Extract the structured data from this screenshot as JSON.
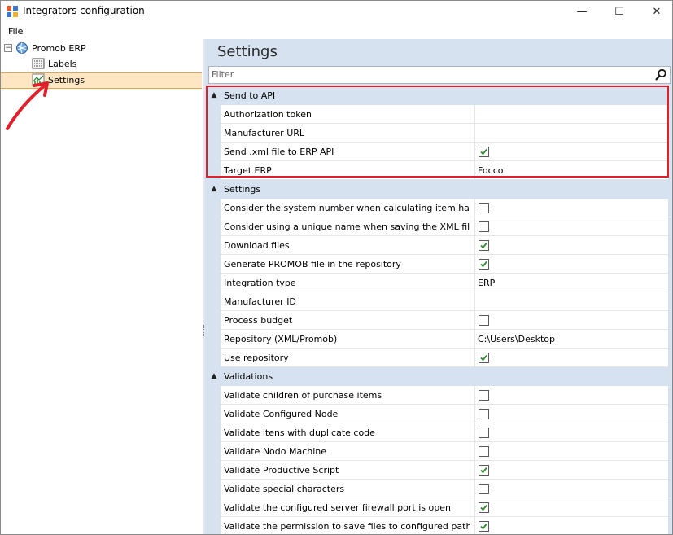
{
  "window": {
    "title": "Integrators configuration",
    "buttons": {
      "minimize": "—",
      "maximize": "☐",
      "close": "✕"
    }
  },
  "menu": {
    "file": "File"
  },
  "tree": {
    "root": {
      "label": "Promob ERP",
      "expander": "⊟",
      "icon": "globe-icon"
    },
    "children": [
      {
        "label": "Labels",
        "icon": "labels-icon",
        "selected": false
      },
      {
        "label": "Settings",
        "icon": "chart-icon",
        "selected": true
      }
    ]
  },
  "settings": {
    "title": "Settings",
    "filter_placeholder": "Filter",
    "categories": [
      {
        "label": "Send to API",
        "rows": [
          {
            "name": "Authorization token",
            "type": "text",
            "value": ""
          },
          {
            "name": "Manufacturer URL",
            "type": "text",
            "value": ""
          },
          {
            "name": "Send .xml file to ERP API",
            "type": "check",
            "checked": true
          },
          {
            "name": "Target ERP",
            "type": "text",
            "value": "Focco"
          }
        ]
      },
      {
        "label": "Settings",
        "rows": [
          {
            "name": "Consider the system number when calculating item hash",
            "type": "check",
            "checked": false
          },
          {
            "name": "Consider using a unique name when saving the XML file.",
            "type": "check",
            "checked": false
          },
          {
            "name": "Download files",
            "type": "check",
            "checked": true
          },
          {
            "name": "Generate PROMOB file in the repository",
            "type": "check",
            "checked": true
          },
          {
            "name": "Integration type",
            "type": "text",
            "value": "ERP"
          },
          {
            "name": "Manufacturer ID",
            "type": "text",
            "value": ""
          },
          {
            "name": "Process budget",
            "type": "check",
            "checked": false
          },
          {
            "name": "Repository (XML/Promob)",
            "type": "text",
            "value": "C:\\Users\\Desktop"
          },
          {
            "name": "Use repository",
            "type": "check",
            "checked": true
          }
        ]
      },
      {
        "label": "Validations",
        "rows": [
          {
            "name": "Validate children of purchase items",
            "type": "check",
            "checked": false
          },
          {
            "name": "Validate Configured Node",
            "type": "check",
            "checked": false
          },
          {
            "name": "Validate itens with duplicate code",
            "type": "check",
            "checked": false
          },
          {
            "name": "Validate Nodo Machine",
            "type": "check",
            "checked": false
          },
          {
            "name": "Validate Productive Script",
            "type": "check",
            "checked": true
          },
          {
            "name": "Validate special characters",
            "type": "check",
            "checked": false
          },
          {
            "name": "Validate the configured server firewall port is open",
            "type": "check",
            "checked": true
          },
          {
            "name": "Validate the permission to save files to configured path",
            "type": "check",
            "checked": true
          }
        ]
      }
    ]
  },
  "colors": {
    "highlight_box": "#e0202a",
    "arrow": "#e0202a",
    "selection": "#fde6c1",
    "check": "#2e8b2e"
  }
}
